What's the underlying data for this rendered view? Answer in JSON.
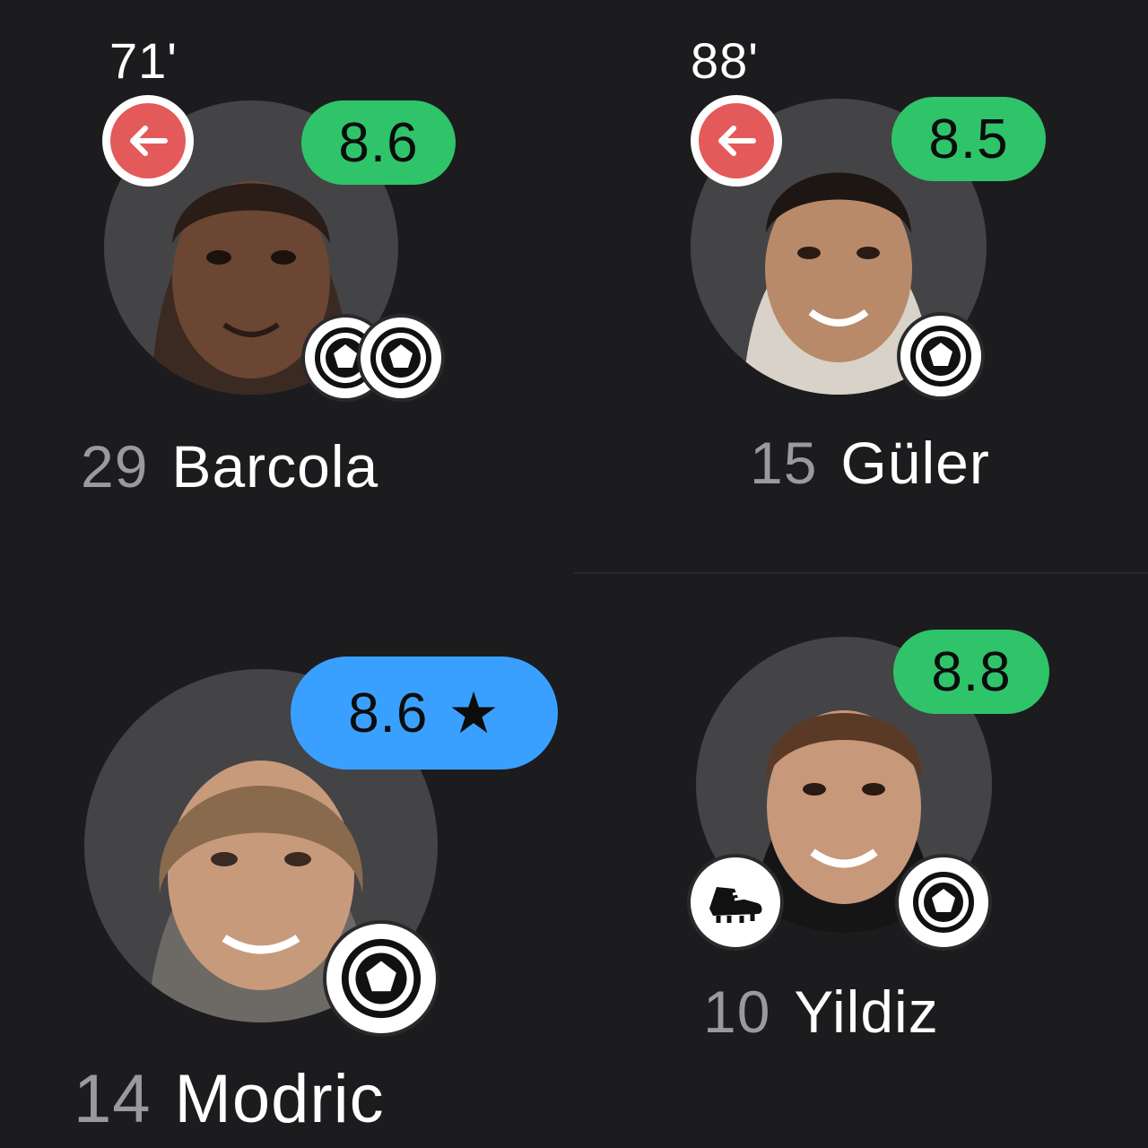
{
  "players": [
    {
      "number": "29",
      "name": "Barcola",
      "rating": "8.6",
      "minute": "71'",
      "subbed_off": true,
      "rating_color": "#2fc46a",
      "events": [
        "goal-icon",
        "goal-icon"
      ]
    },
    {
      "number": "15",
      "name": "Güler",
      "rating": "8.5",
      "minute": "88'",
      "subbed_off": true,
      "rating_color": "#2fc46a",
      "events": [
        "goal-icon"
      ]
    },
    {
      "number": "14",
      "name": "Modric",
      "rating": "8.6",
      "star": "★",
      "player_of_match": true,
      "rating_color": "#3aa0ff",
      "events": [
        "goal-icon"
      ]
    },
    {
      "number": "10",
      "name": "Yildiz",
      "rating": "8.8",
      "rating_color": "#2fc46a",
      "events": [
        "assist-boot-icon",
        "goal-icon"
      ]
    }
  ],
  "colors": {
    "background": "#1c1c1e",
    "rating_green": "#2fc46a",
    "rating_blue": "#3aa0ff",
    "sub_off_red": "#e45a5a"
  }
}
